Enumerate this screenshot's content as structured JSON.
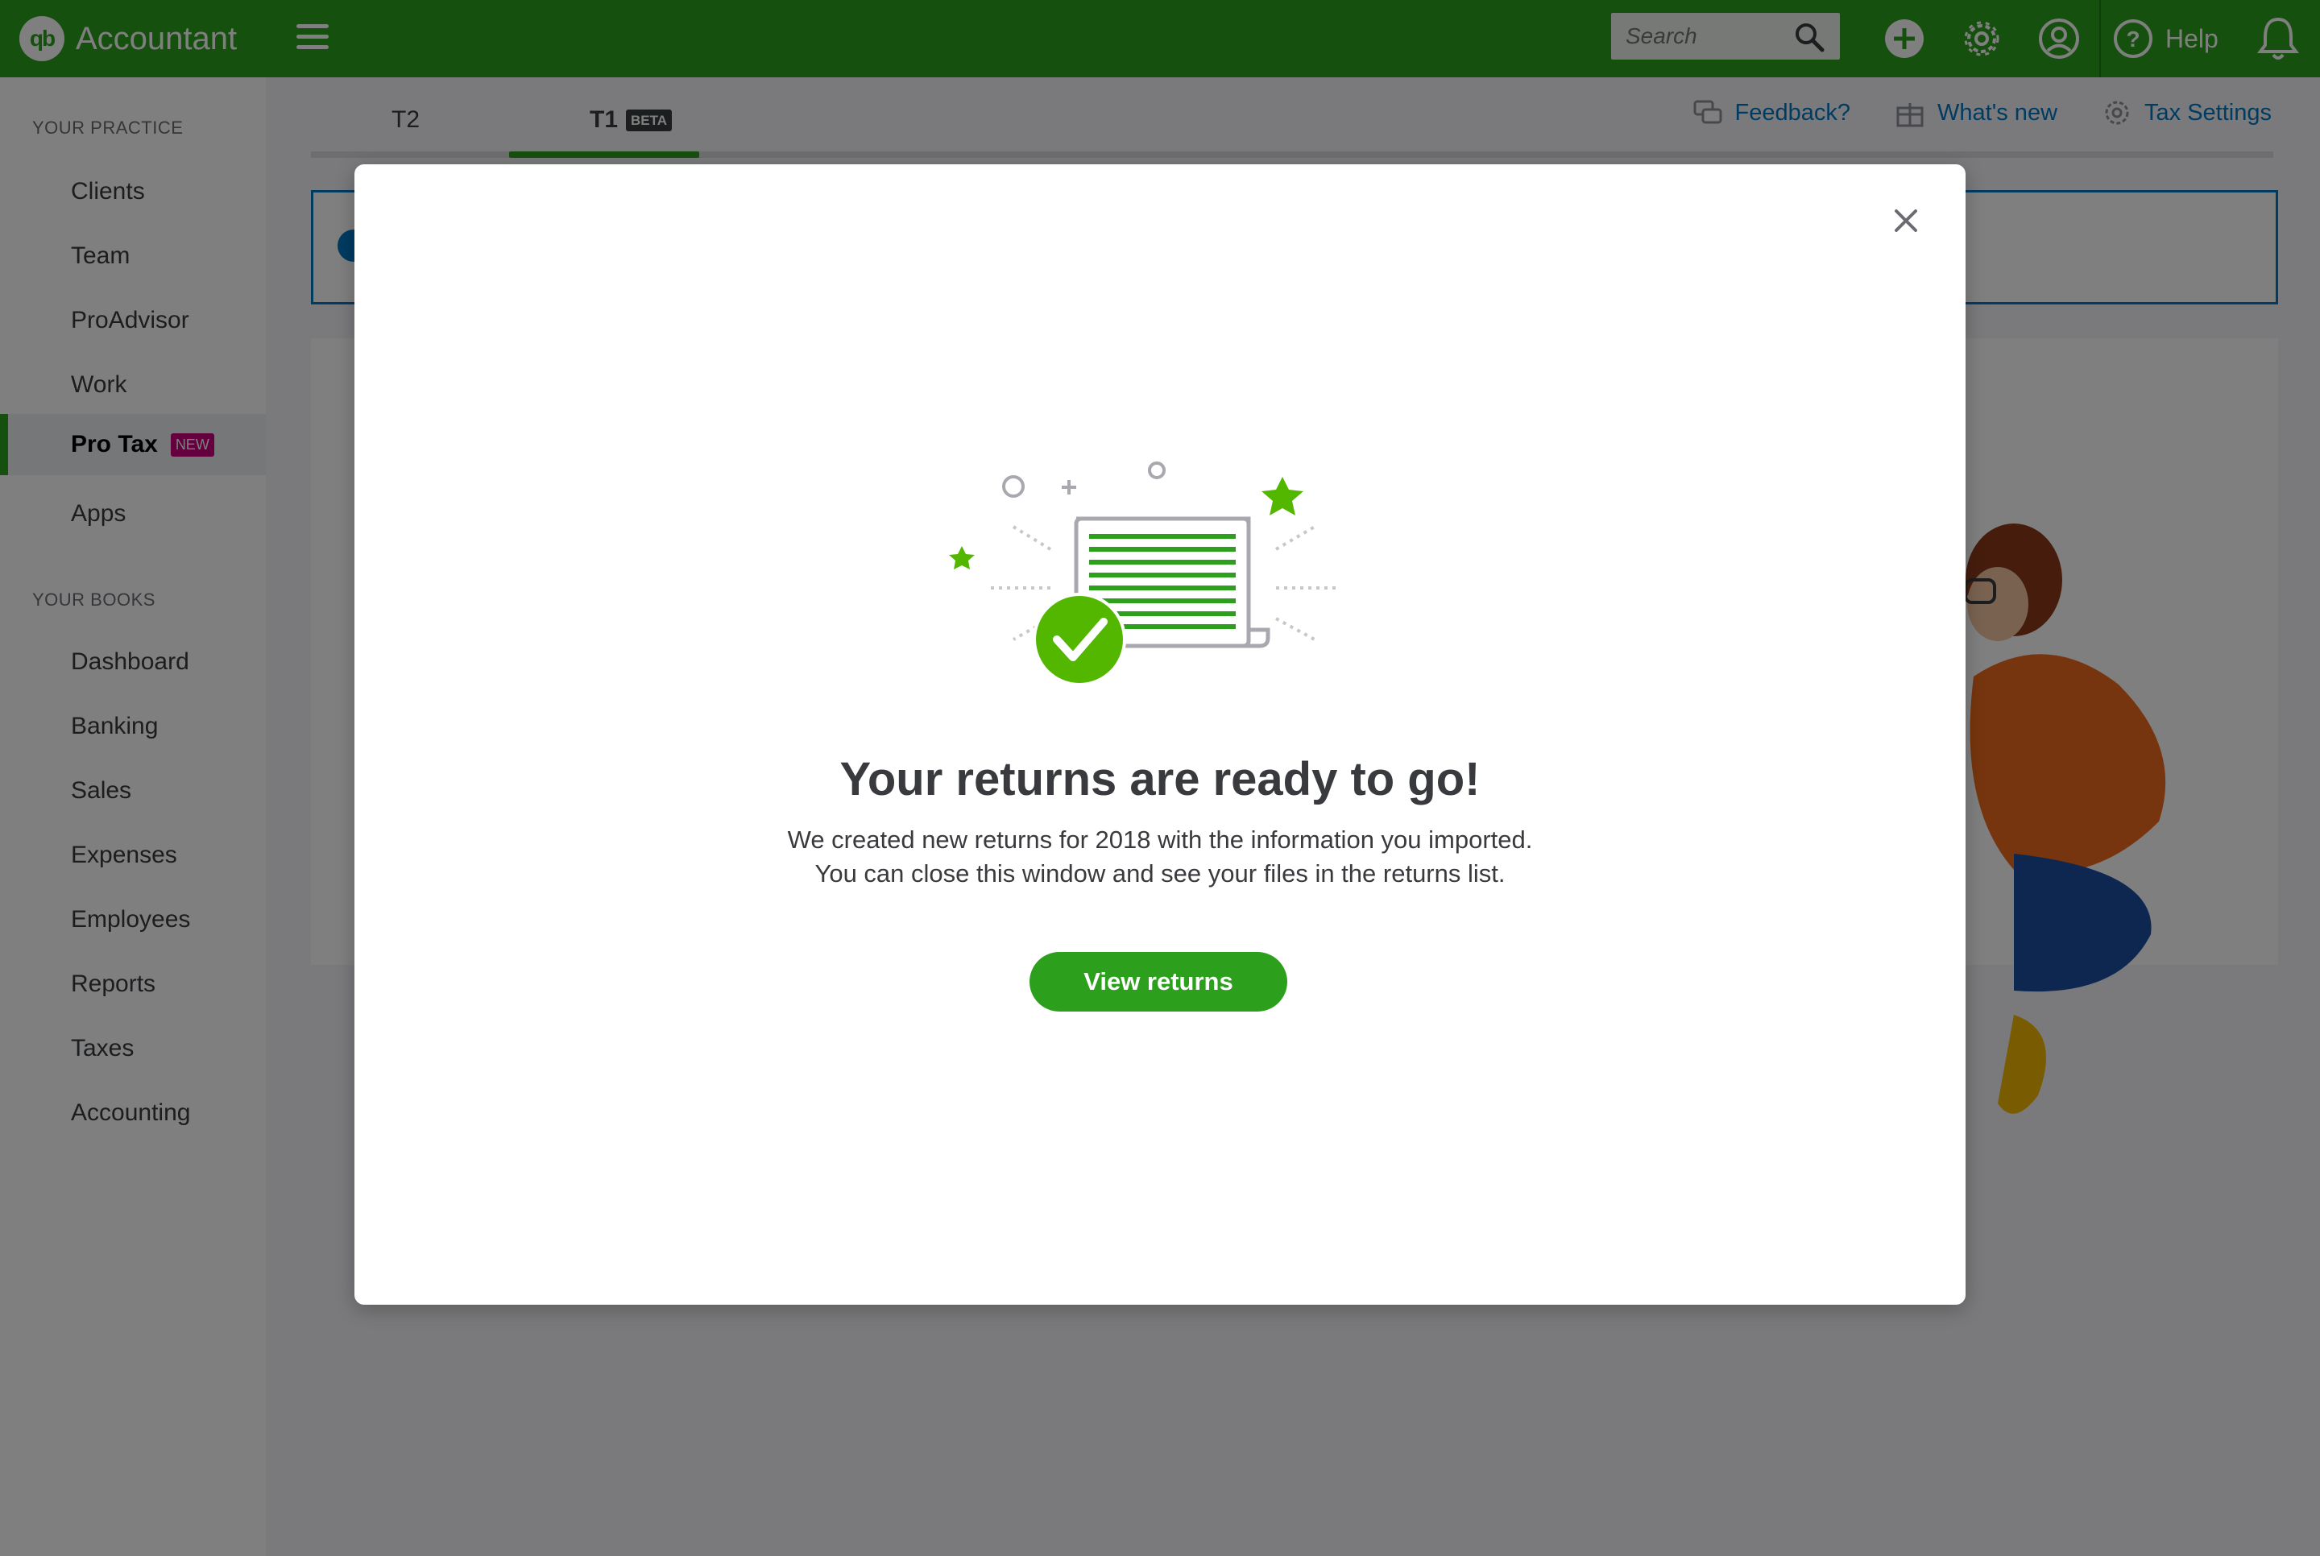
{
  "app": {
    "logo_mark": "qb",
    "logo_text": "Accountant"
  },
  "topbar": {
    "search_placeholder": "Search",
    "help_label": "Help"
  },
  "sidebar": {
    "practice_heading": "YOUR PRACTICE",
    "practice_items": [
      {
        "label": "Clients"
      },
      {
        "label": "Team"
      },
      {
        "label": "ProAdvisor"
      },
      {
        "label": "Work"
      },
      {
        "label": "Pro Tax",
        "badge": "NEW",
        "active": true
      },
      {
        "label": "Apps"
      }
    ],
    "books_heading": "YOUR BOOKS",
    "books_items": [
      {
        "label": "Dashboard"
      },
      {
        "label": "Banking"
      },
      {
        "label": "Sales"
      },
      {
        "label": "Expenses"
      },
      {
        "label": "Employees"
      },
      {
        "label": "Reports"
      },
      {
        "label": "Taxes"
      },
      {
        "label": "Accounting"
      }
    ]
  },
  "main": {
    "tabs": [
      {
        "label": "T2"
      },
      {
        "label": "T1",
        "badge": "BETA",
        "active": true
      }
    ],
    "links": {
      "feedback": "Feedback?",
      "whats_new": "What's new",
      "tax_settings": "Tax Settings"
    }
  },
  "modal": {
    "title": "Your returns are ready to go!",
    "message_line1": "We created new returns for 2018 with the information you imported.",
    "message_line2": "You can close this window and see your files in the returns list.",
    "primary_button": "View returns"
  },
  "colors": {
    "brand_green": "#2ca01c",
    "link_blue": "#0077c5",
    "badge_new": "#c9007a"
  }
}
